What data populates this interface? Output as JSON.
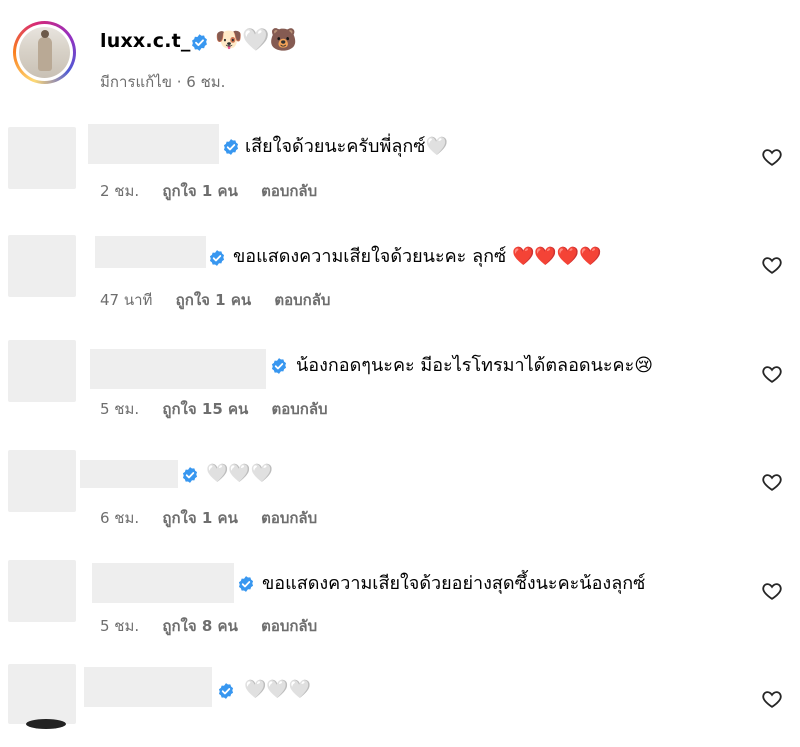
{
  "post": {
    "username": "luxx.c.t_",
    "header_emojis": "🐶🤍🐻",
    "meta": "มีการแก้ไข · 6 ชม."
  },
  "comments": [
    {
      "text": "เสียใจด้วยนะครับพี่ลุกซ์🤍",
      "time": "2 ชม.",
      "likes": "ถูกใจ 1 คน",
      "reply": "ตอบกลับ"
    },
    {
      "text": "ขอแสดงความเสียใจด้วยนะคะ ลุกซ์ ❤️❤️❤️❤️",
      "time": "47 นาที",
      "likes": "ถูกใจ 1 คน",
      "reply": "ตอบกลับ"
    },
    {
      "text": "น้องกอดๆนะคะ มีอะไรโทรมาได้ตลอดนะคะ😢",
      "time": "5 ชม.",
      "likes": "ถูกใจ 15 คน",
      "reply": "ตอบกลับ"
    },
    {
      "text": "🤍🤍🤍",
      "time": "6 ชม.",
      "likes": "ถูกใจ 1 คน",
      "reply": "ตอบกลับ"
    },
    {
      "text": "ขอแสดงความเสียใจด้วยอย่างสุดซึ้งนะคะน้องลุกซ์",
      "time": "5 ชม.",
      "likes": "ถูกใจ 8 คน",
      "reply": "ตอบกลับ"
    },
    {
      "text": "🤍🤍🤍",
      "time": "",
      "likes": "",
      "reply": ""
    }
  ],
  "icons": {
    "verified": "verified-badge-icon",
    "like": "heart-outline-icon",
    "verified_color": "#3897f0"
  }
}
